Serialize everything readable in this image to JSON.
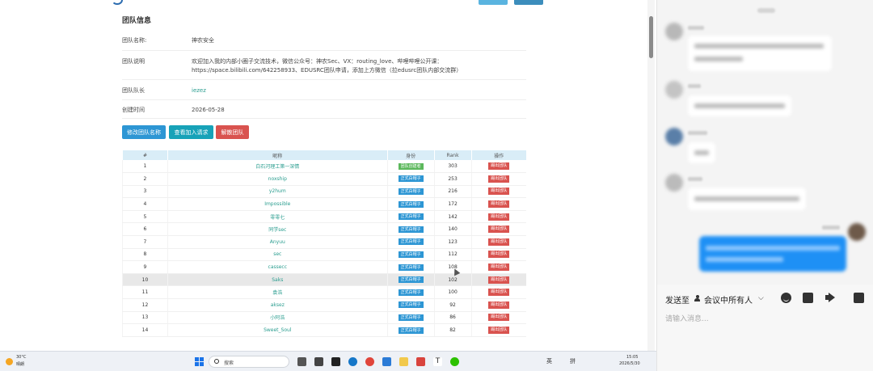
{
  "team": {
    "section_title": "团队信息",
    "fields": [
      {
        "label": "团队名称:",
        "value": "神农安全"
      },
      {
        "label": "团队说明",
        "value": "欢迎加入我的内部小圈子交流技术，微信公众号：神农Sec、VX：routing_love、哔哩哔哩公开课：https://space.bilibili.com/642258933、EDUSRC团队申请，添加上方微信（拉edusrc团队内部交流群）"
      },
      {
        "label": "团队队长",
        "value": "iezez"
      },
      {
        "label": "创建时间",
        "value": "2026-05-28"
      }
    ],
    "buttons": {
      "rename": "修改团队名称",
      "view_requests": "查看加入请求",
      "dissolve": "解散团队"
    }
  },
  "table": {
    "headers": [
      "#",
      "昵称",
      "身份",
      "Rank",
      "操作"
    ],
    "kick_label": "踢出团队",
    "rows": [
      {
        "num": "1",
        "name": "白石河理工第一深情",
        "tag": "团队创建者",
        "rank": "303"
      },
      {
        "num": "2",
        "name": "noxship",
        "tag": "正式白帽子",
        "rank": "253"
      },
      {
        "num": "3",
        "name": "y2hum",
        "tag": "正式白帽子",
        "rank": "216"
      },
      {
        "num": "4",
        "name": "Impossible",
        "tag": "正式白帽子",
        "rank": "172"
      },
      {
        "num": "5",
        "name": "零零七",
        "tag": "正式白帽子",
        "rank": "142"
      },
      {
        "num": "6",
        "name": "同学sec",
        "tag": "正式白帽子",
        "rank": "140"
      },
      {
        "num": "7",
        "name": "Anyuu",
        "tag": "正式白帽子",
        "rank": "123"
      },
      {
        "num": "8",
        "name": "sec",
        "tag": "正式白帽子",
        "rank": "112"
      },
      {
        "num": "9",
        "name": "cassecc",
        "tag": "正式白帽子",
        "rank": "108"
      },
      {
        "num": "10",
        "name": "Saks",
        "tag": "正式白帽子",
        "rank": "102"
      },
      {
        "num": "11",
        "name": "袁浩",
        "tag": "正式白帽子",
        "rank": "100"
      },
      {
        "num": "12",
        "name": "aksez",
        "tag": "正式白帽子",
        "rank": "92"
      },
      {
        "num": "13",
        "name": "小阿浩",
        "tag": "正式白帽子",
        "rank": "86"
      },
      {
        "num": "14",
        "name": "Sweet_Soul",
        "tag": "正式白帽子",
        "rank": "82"
      }
    ]
  },
  "taskbar": {
    "weather_temp": "30°C",
    "weather_desc": "晴朗",
    "search_placeholder": "搜索",
    "tray_lang": "英",
    "tray_ime": "拼",
    "clock_time": "15:05",
    "clock_date": "2026/5/30"
  },
  "chat": {
    "send_to_label": "发送至",
    "send_target": "会议中所有人",
    "input_placeholder": "请输入消息...",
    "colors": {
      "my_bubble": "#1e90f5",
      "accent": "#1a73e8"
    }
  }
}
